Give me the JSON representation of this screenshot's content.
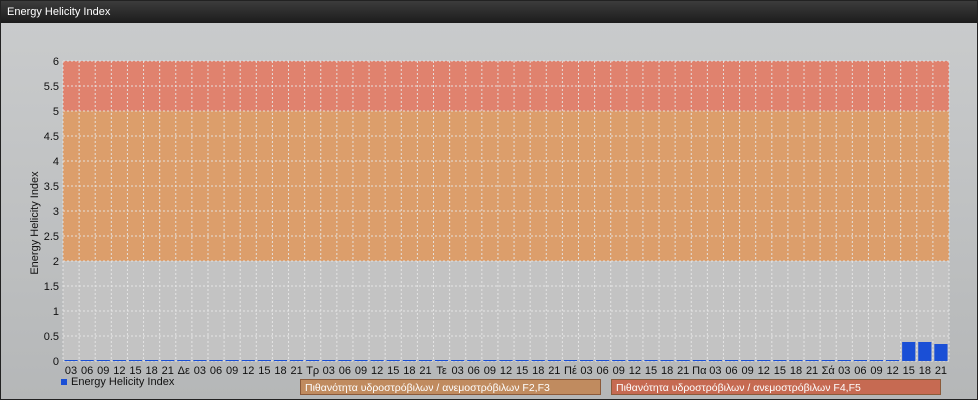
{
  "window": {
    "title": "Energy Helicity Index"
  },
  "legend": {
    "series_label": "Energy Helicity Index",
    "band_1": "Πιθανότητα υδροστρόβιλων / ανεμοστρόβιλων F2,F3",
    "band_2": "Πιθανότητα υδροστρόβιλων / ανεμοστρόβιλων F4,F5"
  },
  "colors": {
    "bar": "#1a4fd6",
    "band_low": "#c3c3c3",
    "band_mid": "#dc9e6b",
    "band_high": "#e0826e",
    "grid": "#e8e8e8"
  },
  "chart_data": {
    "type": "bar",
    "ylabel": "Energy Helicity Index",
    "ylim": [
      0,
      6
    ],
    "yticks": [
      "0",
      "0.5",
      "1",
      "1.5",
      "2",
      "2.5",
      "3",
      "3.5",
      "4",
      "4.5",
      "5",
      "5.5",
      "6"
    ],
    "bands": [
      {
        "from": 0,
        "to": 2,
        "color": "#c3c3c3"
      },
      {
        "from": 2,
        "to": 5,
        "color": "#dc9e6b"
      },
      {
        "from": 5,
        "to": 6,
        "color": "#e0826e"
      }
    ],
    "categories": [
      "03",
      "06",
      "09",
      "12",
      "15",
      "18",
      "21",
      "Δε",
      "03",
      "06",
      "09",
      "12",
      "15",
      "18",
      "21",
      "Τρ",
      "03",
      "06",
      "09",
      "12",
      "15",
      "18",
      "21",
      "Τε",
      "03",
      "06",
      "09",
      "12",
      "15",
      "18",
      "21",
      "Πέ",
      "03",
      "06",
      "09",
      "12",
      "15",
      "18",
      "21",
      "Πα",
      "03",
      "06",
      "09",
      "12",
      "15",
      "18",
      "21",
      "Σά",
      "03",
      "06",
      "09",
      "12",
      "15",
      "18",
      "21"
    ],
    "series": [
      {
        "name": "Energy Helicity Index",
        "values": [
          0.01,
          0.01,
          0.01,
          0.01,
          0.02,
          0.02,
          0.01,
          0.01,
          0.01,
          0.01,
          0.01,
          0.01,
          0.01,
          0.01,
          0.01,
          0.01,
          0.01,
          0.01,
          0.01,
          0.01,
          0.01,
          0.01,
          0.01,
          0.01,
          0.01,
          0.01,
          0.01,
          0.01,
          0.01,
          0.01,
          0.01,
          0.01,
          0.01,
          0.01,
          0.01,
          0.01,
          0.02,
          0.01,
          0.01,
          0.01,
          0.01,
          0.01,
          0.01,
          0.01,
          0.01,
          0.01,
          0.02,
          0.02,
          0.01,
          0.01,
          0.01,
          0.01,
          0.38,
          0.38,
          0.34
        ]
      }
    ]
  }
}
